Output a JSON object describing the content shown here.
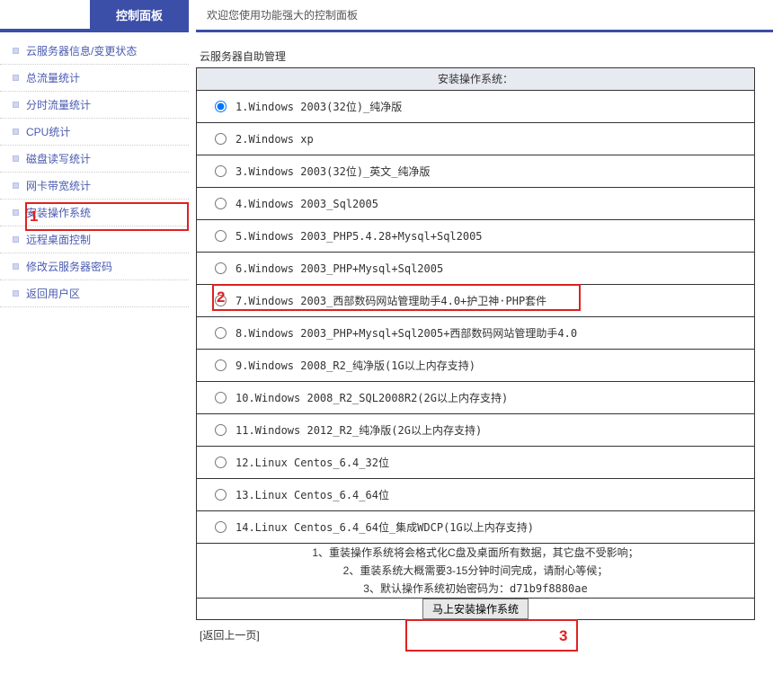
{
  "sidebar": {
    "title": "控制面板",
    "items": [
      {
        "label": "云服务器信息/变更状态"
      },
      {
        "label": "总流量统计"
      },
      {
        "label": "分时流量统计"
      },
      {
        "label": "CPU统计"
      },
      {
        "label": "磁盘读写统计"
      },
      {
        "label": "网卡带宽统计"
      },
      {
        "label": "安装操作系统"
      },
      {
        "label": "远程桌面控制"
      },
      {
        "label": "修改云服务器密码"
      },
      {
        "label": "返回用户区"
      }
    ]
  },
  "main": {
    "welcome": "欢迎您使用功能强大的控制面板",
    "section_title": "云服务器自助管理",
    "table_header": "安装操作系统：",
    "options": [
      {
        "label": "1.Windows 2003(32位)_纯净版"
      },
      {
        "label": "2.Windows xp"
      },
      {
        "label": "3.Windows 2003(32位)_英文_纯净版"
      },
      {
        "label": "4.Windows 2003_Sql2005"
      },
      {
        "label": "5.Windows 2003_PHP5.4.28+Mysql+Sql2005"
      },
      {
        "label": "6.Windows 2003_PHP+Mysql+Sql2005"
      },
      {
        "label": "7.Windows 2003_西部数码网站管理助手4.0+护卫神·PHP套件"
      },
      {
        "label": "8.Windows 2003_PHP+Mysql+Sql2005+西部数码网站管理助手4.0"
      },
      {
        "label": "9.Windows 2008_R2_纯净版(1G以上内存支持)"
      },
      {
        "label": "10.Windows 2008_R2_SQL2008R2(2G以上内存支持)"
      },
      {
        "label": "11.Windows 2012_R2_纯净版(2G以上内存支持)"
      },
      {
        "label": "12.Linux Centos_6.4_32位"
      },
      {
        "label": "13.Linux Centos_6.4_64位"
      },
      {
        "label": "14.Linux Centos_6.4_64位_集成WDCP(1G以上内存支持)"
      }
    ],
    "notes": {
      "line1": "1、重装操作系统将会格式化C盘及桌面所有数据，其它盘不受影响；",
      "line2": "2、重装系统大概需要3-15分钟时间完成，请耐心等候；",
      "line3_prefix": "3、默认操作系统初始密码为：",
      "default_password": "d71b9f8880ae"
    },
    "submit_label": "马上安装操作系统",
    "back_label": "[返回上一页]"
  },
  "annotations": {
    "n1": "1",
    "n2": "2",
    "n3": "3"
  }
}
